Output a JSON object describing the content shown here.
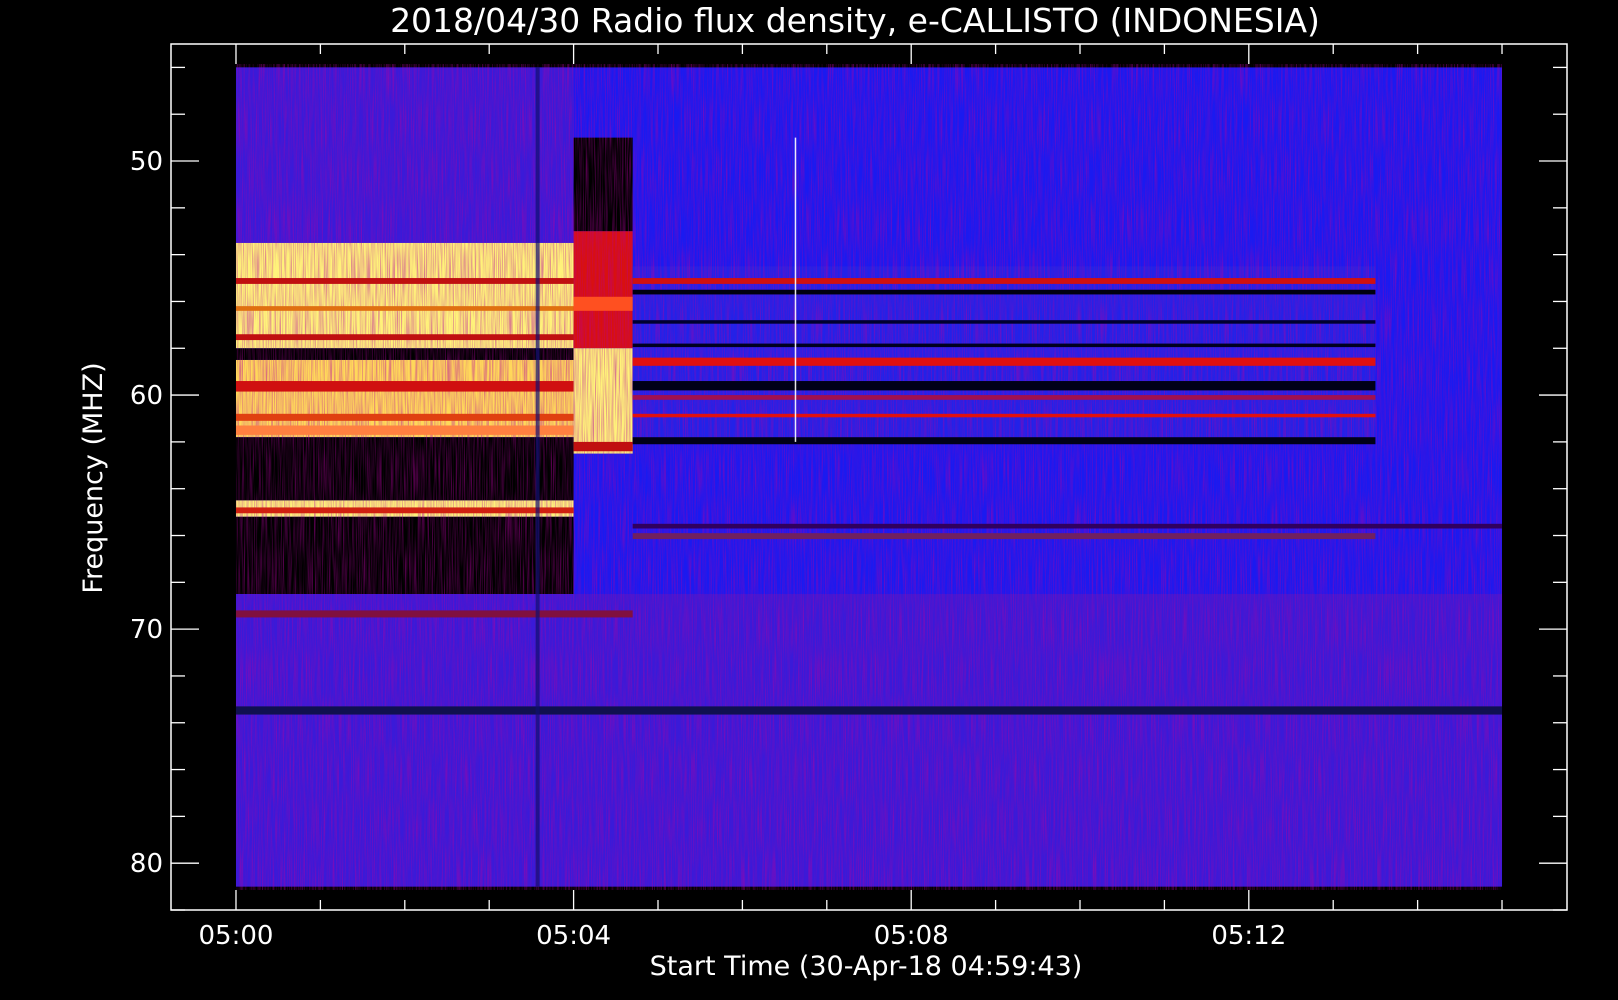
{
  "chart_data": {
    "type": "heatmap",
    "title": "2018/04/30  Radio flux density, e-CALLISTO (INDONESIA)",
    "xlabel": "Start Time (30-Apr-18 04:59:43)",
    "ylabel": "Frequency (MHZ)",
    "x_ticks": [
      {
        "label": "05:00",
        "minutes": 0
      },
      {
        "label": "05:04",
        "minutes": 4
      },
      {
        "label": "05:08",
        "minutes": 8
      },
      {
        "label": "05:12",
        "minutes": 12
      }
    ],
    "y_ticks": [
      {
        "label": "50",
        "mhz": 50
      },
      {
        "label": "60",
        "mhz": 60
      },
      {
        "label": "70",
        "mhz": 70
      },
      {
        "label": "80",
        "mhz": 80
      }
    ],
    "x_range_minutes": [
      -0.77,
      15.77
    ],
    "y_range_mhz": [
      45.0,
      82.0
    ],
    "y_inverted": true,
    "data_extent": {
      "t_start": 0.0,
      "t_end": 15.0,
      "f_low": 46.0,
      "f_high": 81.0
    },
    "colormap": [
      "#000000",
      "#0000ff",
      "#ff0000",
      "#ffff66"
    ],
    "colors": {
      "background": "#000000",
      "foreground": "#ffffff",
      "base": "#1a1af0"
    },
    "regions": [
      {
        "t0": 0.0,
        "t1": 4.0,
        "f0": 46.0,
        "f1": 53.5,
        "level": "blue-purple"
      },
      {
        "t0": 0.0,
        "t1": 4.0,
        "f0": 53.5,
        "f1": 58.0,
        "level": "yellow"
      },
      {
        "t0": 0.0,
        "t1": 4.0,
        "f0": 58.0,
        "f1": 58.5,
        "level": "black"
      },
      {
        "t0": 0.0,
        "t1": 4.0,
        "f0": 58.5,
        "f1": 61.8,
        "level": "yellow-orange"
      },
      {
        "t0": 0.0,
        "t1": 4.0,
        "f0": 61.8,
        "f1": 64.5,
        "level": "black"
      },
      {
        "t0": 0.0,
        "t1": 4.0,
        "f0": 64.5,
        "f1": 65.2,
        "level": "yellow"
      },
      {
        "t0": 0.0,
        "t1": 4.0,
        "f0": 65.2,
        "f1": 68.5,
        "level": "black"
      },
      {
        "t0": 4.0,
        "t1": 4.7,
        "f0": 49.0,
        "f1": 53.0,
        "level": "black"
      },
      {
        "t0": 4.0,
        "t1": 4.7,
        "f0": 53.0,
        "f1": 58.0,
        "level": "red"
      },
      {
        "t0": 4.0,
        "t1": 4.7,
        "f0": 58.0,
        "f1": 62.5,
        "level": "yellow"
      },
      {
        "t0": 4.7,
        "t1": 13.5,
        "f0": 54.5,
        "f1": 62.0,
        "level": "blue-red-stripes"
      },
      {
        "t0": 0.0,
        "t1": 15.0,
        "f0": 68.5,
        "f1": 81.0,
        "level": "blue-purple"
      }
    ]
  }
}
